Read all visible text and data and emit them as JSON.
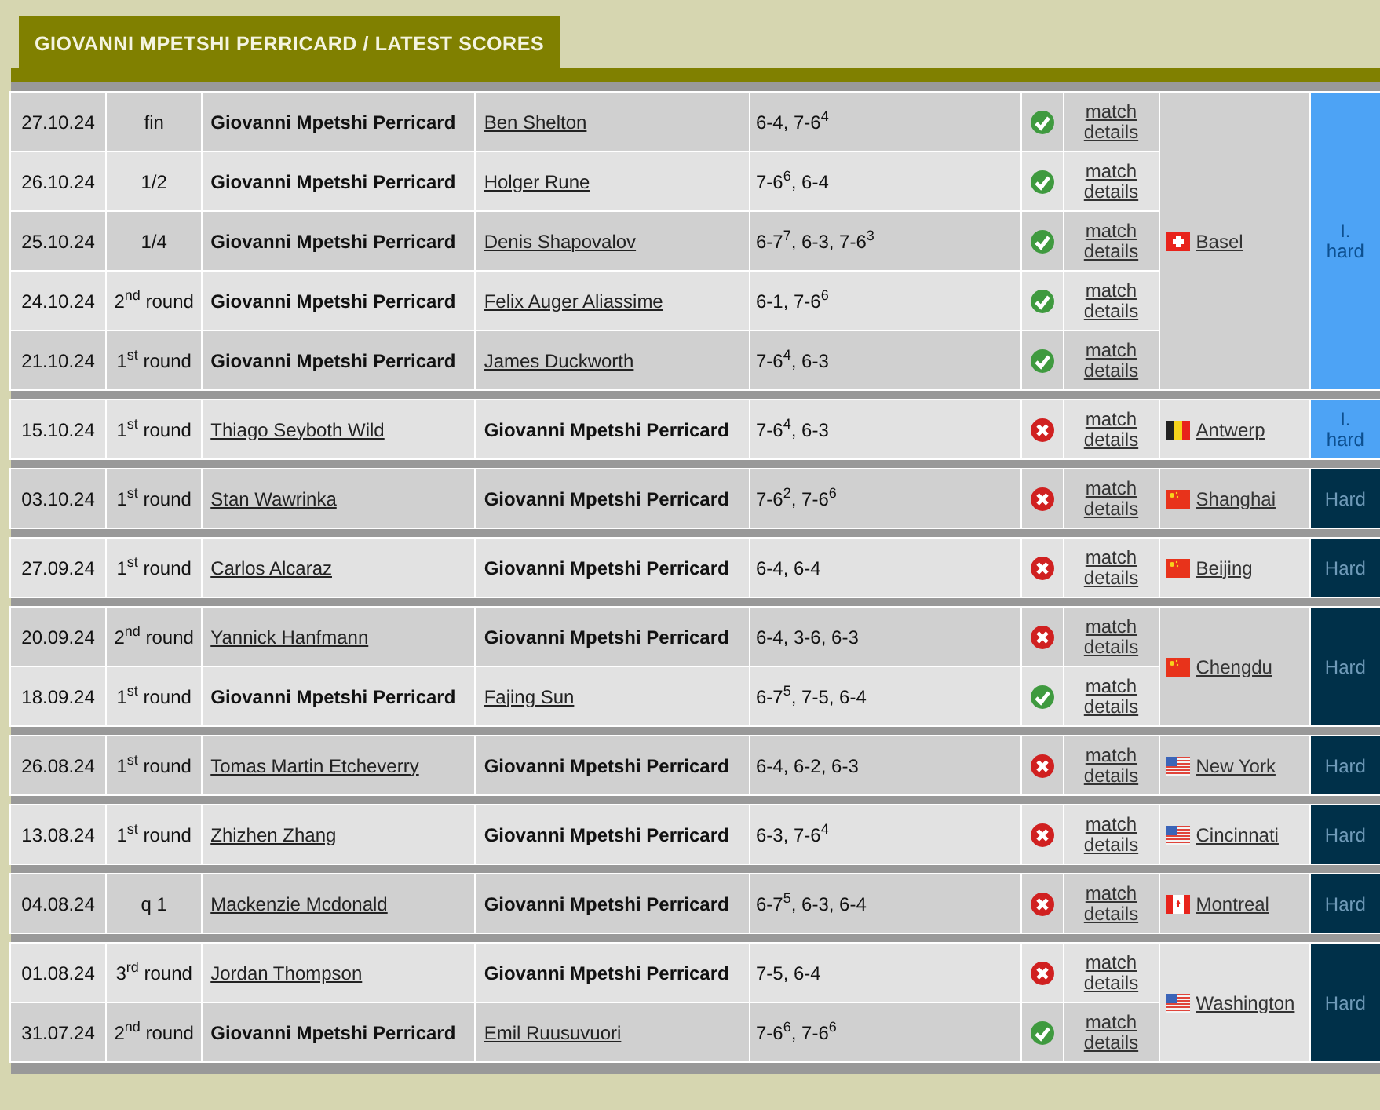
{
  "title": "GIOVANNI MPETSHI PERRICARD / LATEST SCORES",
  "tournaments": [
    {
      "name": "Basel",
      "flag": {
        "kind": "swiss"
      },
      "surface": {
        "kind": "indoor",
        "label": "I. hard"
      },
      "matches": [
        {
          "date": "27.10.24",
          "round": "fin",
          "players": [
            {
              "name": "Giovanni Mpetshi Perricard",
              "subject": true
            },
            {
              "name": "Ben Shelton",
              "subject": false
            }
          ],
          "score": "6-4, 7-6$^{4}$",
          "won": true,
          "details": "match details"
        },
        {
          "date": "26.10.24",
          "round": "1/2",
          "players": [
            {
              "name": "Giovanni Mpetshi Perricard",
              "subject": true
            },
            {
              "name": "Holger Rune",
              "subject": false
            }
          ],
          "score": "7-6$^{6}$, 6-4",
          "won": true,
          "details": "match details"
        },
        {
          "date": "25.10.24",
          "round": "1/4",
          "players": [
            {
              "name": "Giovanni Mpetshi Perricard",
              "subject": true
            },
            {
              "name": "Denis Shapovalov",
              "subject": false
            }
          ],
          "score": "6-7$^{7}$, 6-3, 7-6$^{3}$",
          "won": true,
          "details": "match details"
        },
        {
          "date": "24.10.24",
          "round": "2$^{nd}$ round",
          "players": [
            {
              "name": "Giovanni Mpetshi Perricard",
              "subject": true
            },
            {
              "name": "Felix Auger Aliassime",
              "subject": false
            }
          ],
          "score": "6-1, 7-6$^{6}$",
          "won": true,
          "details": "match details"
        },
        {
          "date": "21.10.24",
          "round": "1$^{st}$ round",
          "players": [
            {
              "name": "Giovanni Mpetshi Perricard",
              "subject": true
            },
            {
              "name": "James Duckworth",
              "subject": false
            }
          ],
          "score": "7-6$^{4}$, 6-3",
          "won": true,
          "details": "match details"
        }
      ]
    },
    {
      "name": "Antwerp",
      "flag": {
        "kind": "belgian"
      },
      "surface": {
        "kind": "indoor",
        "label": "I. hard"
      },
      "matches": [
        {
          "date": "15.10.24",
          "round": "1$^{st}$ round",
          "players": [
            {
              "name": "Thiago Seyboth Wild",
              "subject": false
            },
            {
              "name": "Giovanni Mpetshi Perricard",
              "subject": true
            }
          ],
          "score": "7-6$^{4}$, 6-3",
          "won": false,
          "details": "match details"
        }
      ]
    },
    {
      "name": "Shanghai",
      "flag": {
        "kind": "chinese"
      },
      "surface": {
        "kind": "outdoor",
        "label": "Hard"
      },
      "matches": [
        {
          "date": "03.10.24",
          "round": "1$^{st}$ round",
          "players": [
            {
              "name": "Stan Wawrinka",
              "subject": false
            },
            {
              "name": "Giovanni Mpetshi Perricard",
              "subject": true
            }
          ],
          "score": "7-6$^{2}$, 7-6$^{6}$",
          "won": false,
          "details": "match details"
        }
      ]
    },
    {
      "name": "Beijing",
      "flag": {
        "kind": "chinese"
      },
      "surface": {
        "kind": "outdoor",
        "label": "Hard"
      },
      "matches": [
        {
          "date": "27.09.24",
          "round": "1$^{st}$ round",
          "players": [
            {
              "name": "Carlos Alcaraz",
              "subject": false
            },
            {
              "name": "Giovanni Mpetshi Perricard",
              "subject": true
            }
          ],
          "score": "6-4, 6-4",
          "won": false,
          "details": "match details"
        }
      ]
    },
    {
      "name": "Chengdu",
      "flag": {
        "kind": "chinese"
      },
      "surface": {
        "kind": "outdoor",
        "label": "Hard"
      },
      "matches": [
        {
          "date": "20.09.24",
          "round": "2$^{nd}$ round",
          "players": [
            {
              "name": "Yannick Hanfmann",
              "subject": false
            },
            {
              "name": "Giovanni Mpetshi Perricard",
              "subject": true
            }
          ],
          "score": "6-4, 3-6, 6-3",
          "won": false,
          "details": "match details"
        },
        {
          "date": "18.09.24",
          "round": "1$^{st}$ round",
          "players": [
            {
              "name": "Giovanni Mpetshi Perricard",
              "subject": true
            },
            {
              "name": "Fajing Sun",
              "subject": false
            }
          ],
          "score": "6-7$^{5}$, 7-5, 6-4",
          "won": true,
          "details": "match details"
        }
      ]
    },
    {
      "name": "New York",
      "flag": {
        "kind": "american"
      },
      "surface": {
        "kind": "outdoor",
        "label": "Hard"
      },
      "matches": [
        {
          "date": "26.08.24",
          "round": "1$^{st}$ round",
          "players": [
            {
              "name": "Tomas Martin Etcheverry",
              "subject": false
            },
            {
              "name": "Giovanni Mpetshi Perricard",
              "subject": true
            }
          ],
          "score": "6-4, 6-2, 6-3",
          "won": false,
          "details": "match details"
        }
      ]
    },
    {
      "name": "Cincinnati",
      "flag": {
        "kind": "american"
      },
      "surface": {
        "kind": "outdoor",
        "label": "Hard"
      },
      "matches": [
        {
          "date": "13.08.24",
          "round": "1$^{st}$ round",
          "players": [
            {
              "name": "Zhizhen Zhang",
              "subject": false
            },
            {
              "name": "Giovanni Mpetshi Perricard",
              "subject": true
            }
          ],
          "score": "6-3, 7-6$^{4}$",
          "won": false,
          "details": "match details"
        }
      ]
    },
    {
      "name": "Montreal",
      "flag": {
        "kind": "canadian"
      },
      "surface": {
        "kind": "outdoor",
        "label": "Hard"
      },
      "matches": [
        {
          "date": "04.08.24",
          "round": "q 1",
          "players": [
            {
              "name": "Mackenzie Mcdonald",
              "subject": false
            },
            {
              "name": "Giovanni Mpetshi Perricard",
              "subject": true
            }
          ],
          "score": "6-7$^{5}$, 6-3, 6-4",
          "won": false,
          "details": "match details"
        }
      ]
    },
    {
      "name": "Washington",
      "flag": {
        "kind": "american"
      },
      "surface": {
        "kind": "outdoor",
        "label": "Hard"
      },
      "matches": [
        {
          "date": "01.08.24",
          "round": "3$^{rd}$ round",
          "players": [
            {
              "name": "Jordan Thompson",
              "subject": false
            },
            {
              "name": "Giovanni Mpetshi Perricard",
              "subject": true
            }
          ],
          "score": "7-5, 6-4",
          "won": false,
          "details": "match details"
        },
        {
          "date": "31.07.24",
          "round": "2$^{nd}$ round",
          "players": [
            {
              "name": "Giovanni Mpetshi Perricard",
              "subject": true
            },
            {
              "name": "Emil Ruusuvuori",
              "subject": false
            }
          ],
          "score": "7-6$^{6}$, 7-6$^{6}$",
          "won": true,
          "details": "match details"
        }
      ]
    }
  ]
}
